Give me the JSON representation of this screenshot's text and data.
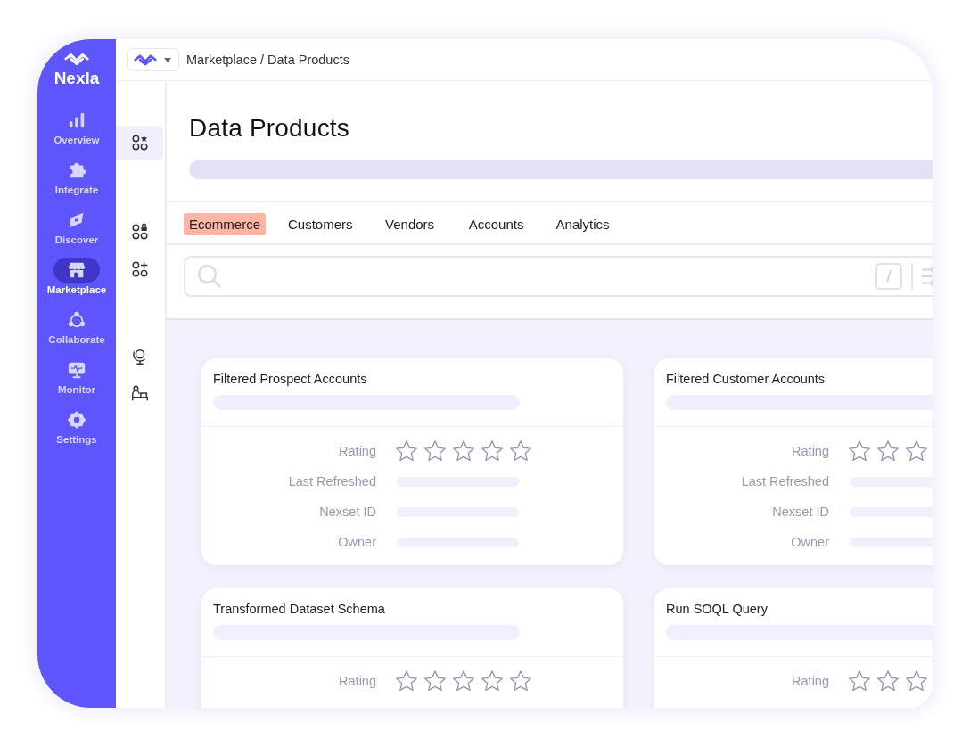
{
  "brand": {
    "name": "Nexla"
  },
  "nav": [
    {
      "label": "Overview",
      "selected": false
    },
    {
      "label": "Integrate",
      "selected": false
    },
    {
      "label": "Discover",
      "selected": false
    },
    {
      "label": "Marketplace",
      "selected": true
    },
    {
      "label": "Collaborate",
      "selected": false
    },
    {
      "label": "Monitor",
      "selected": false
    },
    {
      "label": "Settings",
      "selected": false
    }
  ],
  "rail": [
    {
      "selected": true
    },
    {
      "selected": false
    },
    {
      "selected": false
    },
    {
      "selected": false
    },
    {
      "selected": false
    }
  ],
  "breadcrumb": "Marketplace / Data Products",
  "page_title": "Data Products",
  "tabs": [
    {
      "label": "Ecommerce",
      "selected": true
    },
    {
      "label": "Customers",
      "selected": false
    },
    {
      "label": "Vendors",
      "selected": false
    },
    {
      "label": "Accounts",
      "selected": false
    },
    {
      "label": "Analytics",
      "selected": false
    }
  ],
  "search": {
    "shortcut_key": "/"
  },
  "cards": [
    {
      "title": "Filtered Prospect Accounts",
      "stars": 0,
      "fields": [
        "Rating",
        "Last Refreshed",
        "Nexset ID",
        "Owner"
      ]
    },
    {
      "title": "Filtered Customer Accounts",
      "stars": 0,
      "fields": [
        "Rating",
        "Last Refreshed",
        "Nexset ID",
        "Owner"
      ]
    },
    {
      "title": "Transformed Dataset Schema",
      "stars": 0,
      "fields": [
        "Rating"
      ]
    },
    {
      "title": "Run SOQL Query",
      "stars": 0,
      "fields": [
        "Rating"
      ]
    }
  ]
}
